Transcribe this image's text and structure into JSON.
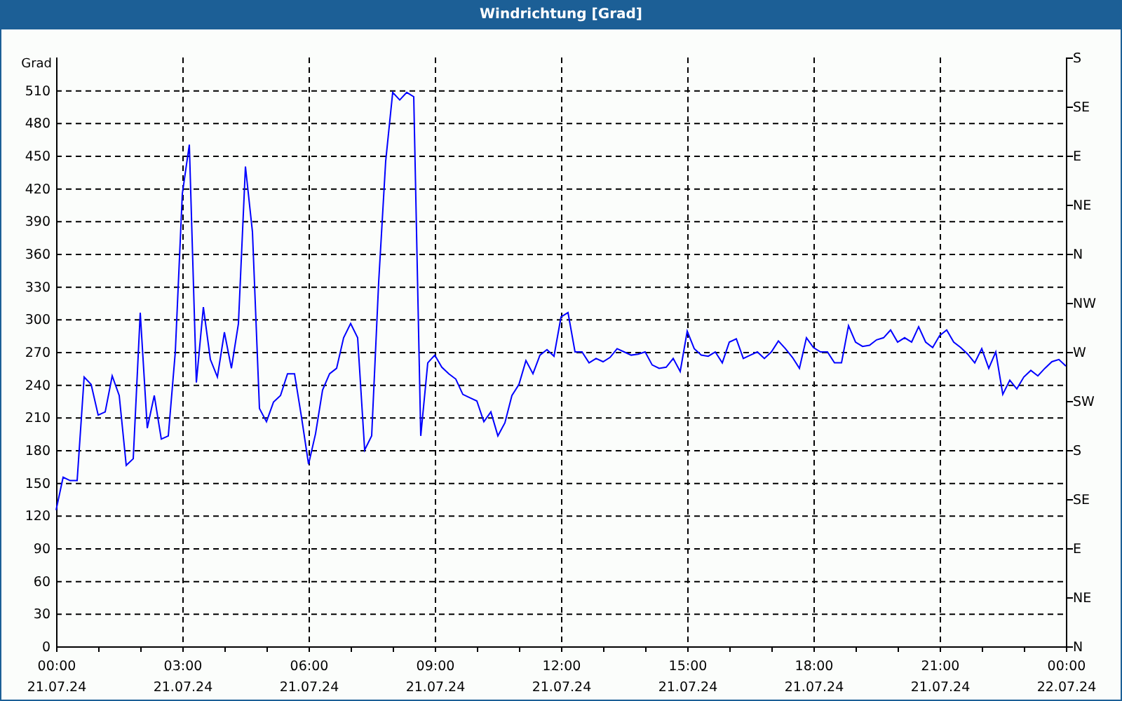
{
  "window": {
    "title": "Windrichtung [Grad]"
  },
  "chart": {
    "chart_data": {
      "type": "line",
      "ylabel": "Grad",
      "ylim": [
        0,
        540
      ],
      "grid": true,
      "yticks": [
        0,
        30,
        60,
        90,
        120,
        150,
        180,
        210,
        240,
        270,
        300,
        330,
        360,
        390,
        420,
        450,
        480,
        510
      ],
      "categories": [
        "00:00\n21.07.24",
        null,
        null,
        null,
        null,
        null,
        null,
        null,
        null,
        null,
        null,
        null,
        null,
        null,
        null,
        null,
        null,
        null,
        "03:00\n21.07.24",
        null,
        null,
        null,
        null,
        null,
        null,
        null,
        null,
        null,
        null,
        null,
        null,
        null,
        null,
        null,
        null,
        null,
        "06:00\n21.07.24",
        null,
        null,
        null,
        null,
        null,
        null,
        null,
        null,
        null,
        null,
        null,
        null,
        null,
        null,
        null,
        null,
        null,
        "09:00\n21.07.24",
        null,
        null,
        null,
        null,
        null,
        null,
        null,
        null,
        null,
        null,
        null,
        null,
        null,
        null,
        null,
        null,
        null,
        "12:00\n21.07.24",
        null,
        null,
        null,
        null,
        null,
        null,
        null,
        null,
        null,
        null,
        null,
        null,
        null,
        null,
        null,
        null,
        null,
        "15:00\n21.07.24",
        null,
        null,
        null,
        null,
        null,
        null,
        null,
        null,
        null,
        null,
        null,
        null,
        null,
        null,
        null,
        null,
        null,
        "18:00\n21.07.24",
        null,
        null,
        null,
        null,
        null,
        null,
        null,
        null,
        null,
        null,
        null,
        null,
        null,
        null,
        null,
        null,
        null,
        "21:00\n21.07.24",
        null,
        null,
        null,
        null,
        null,
        null,
        null,
        null,
        null,
        null,
        null,
        null,
        null,
        null,
        null,
        null,
        null,
        "00:00\n22.07.24"
      ],
      "series": [
        {
          "color": "#0000ff",
          "values": [
            125,
            155,
            152,
            152,
            247,
            240,
            212,
            215,
            248,
            230,
            166,
            172,
            306,
            200,
            230,
            190,
            193,
            270,
            415,
            460,
            242,
            311,
            263,
            247,
            288,
            255,
            296,
            440,
            380,
            218,
            206,
            224,
            230,
            250,
            250,
            210,
            167,
            195,
            235,
            250,
            255,
            283,
            296,
            283,
            180,
            193,
            334,
            445,
            508,
            501,
            508,
            504,
            193,
            260,
            267,
            256,
            250,
            245,
            231,
            228,
            225,
            206,
            215,
            193,
            205,
            230,
            240,
            262,
            250,
            267,
            272,
            266,
            302,
            306,
            270,
            270,
            260,
            264,
            261,
            265,
            273,
            270,
            267,
            268,
            270,
            258,
            255,
            256,
            264,
            252,
            289,
            273,
            267,
            266,
            270,
            260,
            279,
            282,
            264,
            267,
            270,
            264,
            270,
            280,
            273,
            265,
            255,
            283,
            274,
            270,
            270,
            260,
            260,
            294,
            279,
            275,
            276,
            281,
            283,
            290,
            279,
            283,
            279,
            293,
            279,
            274,
            285,
            290,
            279,
            274,
            268,
            260,
            273,
            255,
            270,
            231,
            244,
            236,
            247,
            253,
            248,
            255,
            261,
            263,
            257
          ]
        }
      ]
    },
    "right_axis_labels": [
      "S",
      "SE",
      "E",
      "NE",
      "N",
      "NW",
      "W",
      "SW",
      "S",
      "SE",
      "E",
      "NE",
      "N"
    ]
  }
}
